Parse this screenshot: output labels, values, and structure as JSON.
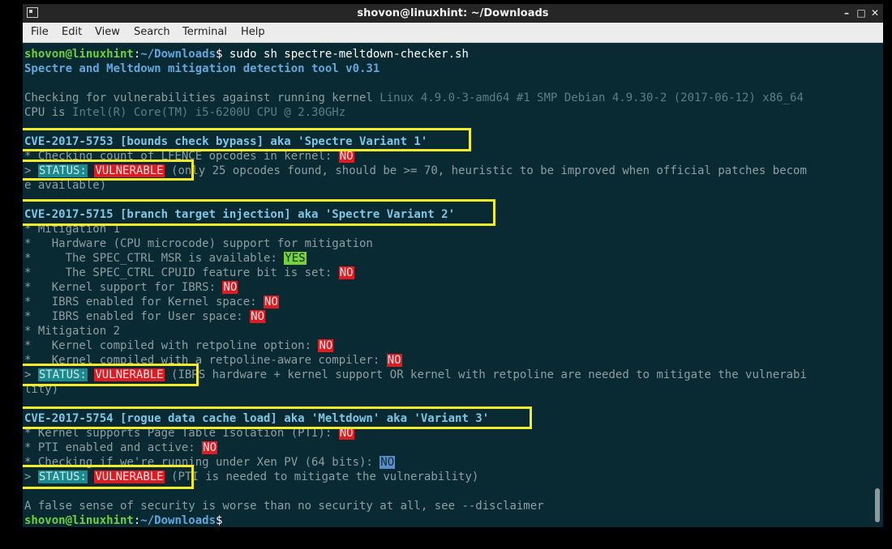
{
  "window": {
    "title": "shovon@linuxhint: ~/Downloads",
    "buttons": {
      "minimize": "–",
      "maximize": "□",
      "close": "✕"
    }
  },
  "menu": [
    "File",
    "Edit",
    "View",
    "Search",
    "Terminal",
    "Help"
  ],
  "prompt": {
    "user": "shovon@linuxhint",
    "colon": ":",
    "path": "~/Downloads",
    "dollar": "$",
    "command": " sudo sh spectre-meltdown-checker.sh"
  },
  "tool_header": "Spectre and Meltdown mitigation detection tool v0.31",
  "kernel_check": {
    "label": "Checking for vulnerabilities against running kernel ",
    "value": "Linux 4.9.0-3-amd64 #1 SMP Debian 4.9.30-2 (2017-06-12) x86_64"
  },
  "cpu": {
    "label": "CPU is ",
    "value": "Intel(R) Core(TM) i5-6200U CPU @ 2.30GHz"
  },
  "cve1": {
    "header": "CVE-2017-5753 [bounds check bypass] aka 'Spectre Variant 1'",
    "lfence_label": "* Checking count of LFENCE opcodes in kernel: ",
    "lfence_value": "NO",
    "status_prefix": "> ",
    "status_label": "STATUS:",
    "status_value": "VULNERABLE",
    "status_note": "(only 25 opcodes found, should be >= 70, heuristic to be improved when official patches becom",
    "status_note_cont": "e available)"
  },
  "cve2": {
    "header": "CVE-2017-5715 [branch target injection] aka 'Spectre Variant 2'",
    "mitigation1": "* Mitigation 1",
    "hw_support": "*   Hardware (CPU microcode) support for mitigation",
    "msr_label": "*     The SPEC_CTRL MSR is available: ",
    "msr_value": "YES",
    "cpuid_label": "*     The SPEC_CTRL CPUID feature bit is set: ",
    "cpuid_value": "NO",
    "ibrs_label": "*   Kernel support for IBRS: ",
    "ibrs_value": "NO",
    "ibrs_kernel_label": "*   IBRS enabled for Kernel space: ",
    "ibrs_kernel_value": "NO",
    "ibrs_user_label": "*   IBRS enabled for User space: ",
    "ibrs_user_value": "NO",
    "mitigation2": "* Mitigation 2",
    "retpoline_label": "*   Kernel compiled with retpoline option: ",
    "retpoline_value": "NO",
    "retpoline_compiler_label": "*   Kernel compiled with a retpoline-aware compiler: ",
    "retpoline_compiler_value": "NO",
    "status_prefix": "> ",
    "status_label": "STATUS:",
    "status_value": "VULNERABLE",
    "status_note": "(IBRS hardware + kernel support OR kernel with retpoline are needed to mitigate the vulnerabi",
    "status_note_cont": "lity)"
  },
  "cve3": {
    "header": "CVE-2017-5754 [rogue data cache load] aka 'Meltdown' aka 'Variant 3'",
    "pti_label": "* Kernel supports Page Table Isolation (PTI): ",
    "pti_value": "NO",
    "pti_enabled_label": "* PTI enabled and active: ",
    "pti_enabled_value": "NO",
    "xen_label": "* Checking if we're running under Xen PV (64 bits): ",
    "xen_value": "NO",
    "status_prefix": "> ",
    "status_label": "STATUS:",
    "status_value": "VULNERABLE",
    "status_note": "(PTI is needed to mitigate the vulnerability)"
  },
  "disclaimer": "A false sense of security is worse than no security at all, see --disclaimer",
  "colors": {
    "terminal_bg": "#0a2a33",
    "highlight_box": "#f2ec2b",
    "tag_red": "#e11b22",
    "tag_green": "#76d238",
    "tag_blue": "#5a8ec8",
    "tag_teal": "#1b8a8f"
  }
}
